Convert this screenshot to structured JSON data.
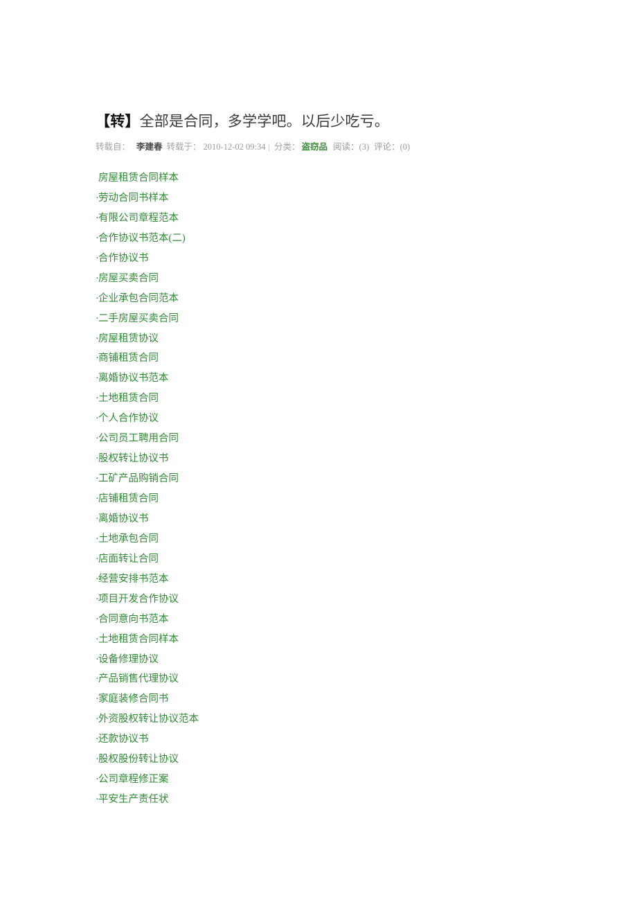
{
  "article": {
    "tag": "【转】",
    "title": "全部是合同，多学学吧。以后少吃亏。"
  },
  "meta": {
    "reposted_from_label": "转载自：",
    "author": "李建春",
    "reposted_on_label": "转载于：",
    "date": "2010-12-02 09:34",
    "separator": "|",
    "category_label": "分类：",
    "category_value": "盗窃品",
    "reads": "阅读：(3)",
    "comments": "评论：(0)"
  },
  "links": [
    {
      "bullet": "",
      "label": "房屋租赁合同样本"
    },
    {
      "bullet": "·",
      "label": "劳动合同书样本"
    },
    {
      "bullet": "·",
      "label": "有限公司章程范本"
    },
    {
      "bullet": "·",
      "label": "合作协议书范本(二)"
    },
    {
      "bullet": "·",
      "label": "合作协议书"
    },
    {
      "bullet": "·",
      "label": "房屋买卖合同"
    },
    {
      "bullet": "·",
      "label": "企业承包合同范本"
    },
    {
      "bullet": "·",
      "label": "二手房屋买卖合同"
    },
    {
      "bullet": "·",
      "label": "房屋租赁协议"
    },
    {
      "bullet": "·",
      "label": "商铺租赁合同"
    },
    {
      "bullet": "·",
      "label": "离婚协议书范本"
    },
    {
      "bullet": "·",
      "label": "土地租赁合同"
    },
    {
      "bullet": "·",
      "label": "个人合作协议"
    },
    {
      "bullet": "·",
      "label": "公司员工聘用合同"
    },
    {
      "bullet": "·",
      "label": "股权转让协议书"
    },
    {
      "bullet": "·",
      "label": "工矿产品购销合同"
    },
    {
      "bullet": "·",
      "label": "店铺租赁合同"
    },
    {
      "bullet": "·",
      "label": "离婚协议书"
    },
    {
      "bullet": "·",
      "label": "土地承包合同"
    },
    {
      "bullet": "·",
      "label": "店面转让合同"
    },
    {
      "bullet": "·",
      "label": "经营安排书范本"
    },
    {
      "bullet": "·",
      "label": "项目开发合作协议"
    },
    {
      "bullet": "·",
      "label": "合同意向书范本"
    },
    {
      "bullet": "·",
      "label": "土地租赁合同样本"
    },
    {
      "bullet": "·",
      "label": "设备修理协议"
    },
    {
      "bullet": "·",
      "label": "产品销售代理协议"
    },
    {
      "bullet": "·",
      "label": "家庭装修合同书"
    },
    {
      "bullet": "·",
      "label": "外资股权转让协议范本"
    },
    {
      "bullet": "·",
      "label": "还款协议书"
    },
    {
      "bullet": "·",
      "label": "股权股份转让协议"
    },
    {
      "bullet": "·",
      "label": "公司章程修正案"
    },
    {
      "bullet": "·",
      "label": "平安生产责任状"
    }
  ],
  "colors": {
    "link_green": "#2f8a34",
    "category_green": "#3a8a3a",
    "title_dark": "#3a3a3a",
    "meta_gray": "#9a9a9a",
    "background": "#ffffff"
  }
}
